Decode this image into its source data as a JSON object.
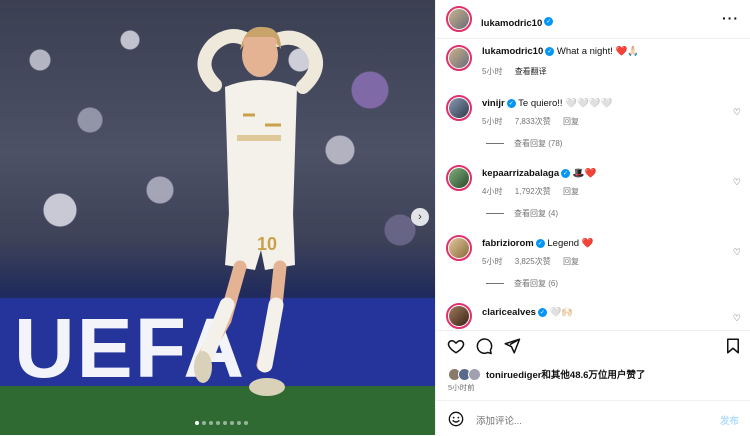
{
  "post": {
    "author": "lukamodric10",
    "caption": "What a night! ❤️🙏🏻",
    "caption_time": "5小时",
    "translate": "查看翻译",
    "image_board_text": "UEFA",
    "carousel": {
      "count": 8,
      "active": 0
    }
  },
  "comments": [
    {
      "user": "vinijr",
      "text": "Te quiero!! 🤍🤍🤍🤍",
      "time": "5小时",
      "likes": "7,833次赞",
      "reply": "回复",
      "view_replies": "查看回复 (78)",
      "avatar_color": "#5a6b82"
    },
    {
      "user": "kepaarrizabalaga",
      "text": "🎩❤️",
      "time": "4小时",
      "likes": "1,792次赞",
      "reply": "回复",
      "view_replies": "查看回复 (4)",
      "avatar_color": "#3b7a4a"
    },
    {
      "user": "fabriziorom",
      "text": "Legend ❤️",
      "time": "5小时",
      "likes": "3,825次赞",
      "reply": "回复",
      "view_replies": "查看回复 (6)",
      "avatar_color": "#b9986a"
    },
    {
      "user": "claricealves",
      "text": "🤍🙌🏻",
      "time": "",
      "likes": "",
      "reply": "",
      "view_replies": "",
      "avatar_color": "#6b4a3a"
    }
  ],
  "likes_summary": "toniruediger和其他48.6万位用户赞了",
  "likes_time": "5小时前",
  "add_comment": {
    "placeholder": "添加评论...",
    "post_label": "发布"
  },
  "colors": {
    "accent": "#0095f6",
    "ring": "#e1306c",
    "board": "#24349a"
  }
}
